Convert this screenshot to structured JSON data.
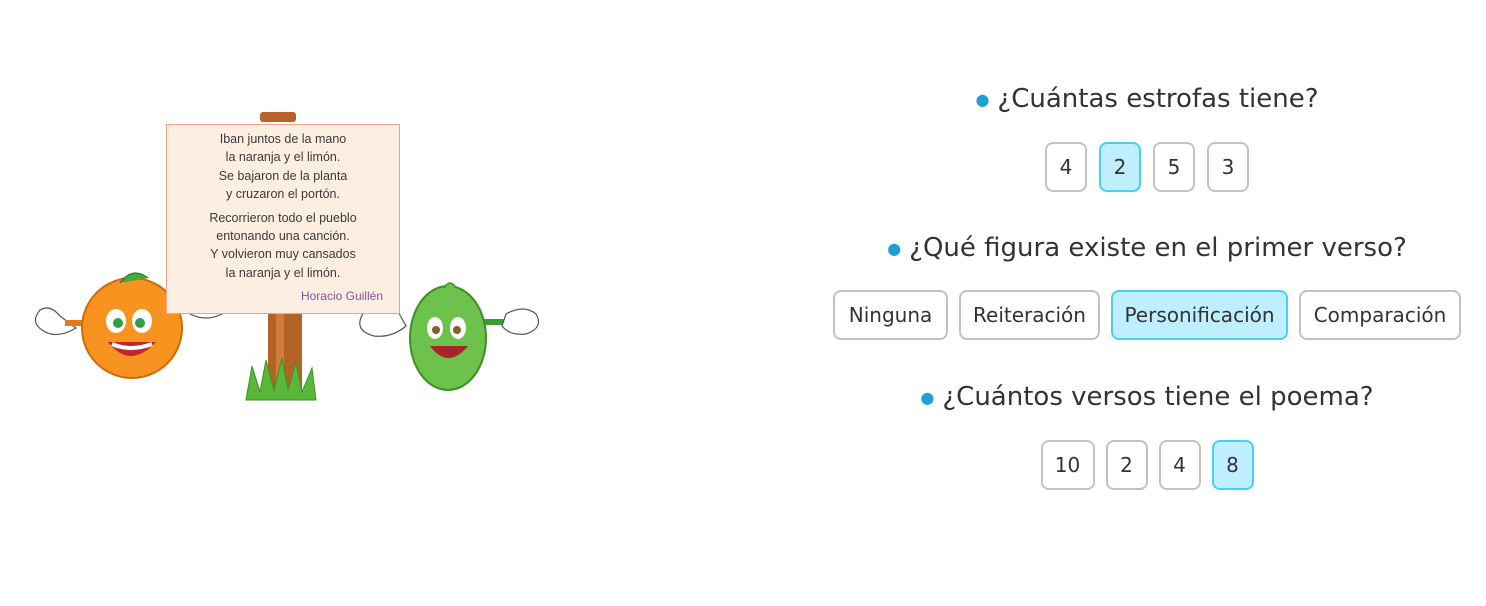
{
  "poem": {
    "stanzas": [
      [
        "Iban juntos de la mano",
        "la naranja y el limón.",
        "Se bajaron de la planta",
        "y cruzaron el portón."
      ],
      [
        "Recorrieron todo el pueblo",
        "entonando una canción.",
        "Y volvieron muy cansados",
        "la naranja y el limón."
      ]
    ],
    "author": "Horacio Guillén"
  },
  "questions": [
    {
      "text": "¿Cuántas estrofas tiene?",
      "options": [
        "4",
        "2",
        "5",
        "3"
      ],
      "selected": "2"
    },
    {
      "text": "¿Qué figura existe en el primer verso?",
      "options": [
        "Ninguna",
        "Reiteración",
        "Personificación",
        "Comparación"
      ],
      "selected": "Personificación"
    },
    {
      "text": "¿Cuántos versos tiene el poema?",
      "options": [
        "10",
        "2",
        "4",
        "8"
      ],
      "selected": "8"
    }
  ],
  "colors": {
    "bullet": "#1e9fd8",
    "selected_bg": "#bfefff",
    "selected_border": "#46d1f0",
    "border": "#c2c2c2"
  },
  "icons": [
    "orange-character-icon",
    "lemon-character-icon",
    "signpost-icon",
    "grass-icon"
  ]
}
